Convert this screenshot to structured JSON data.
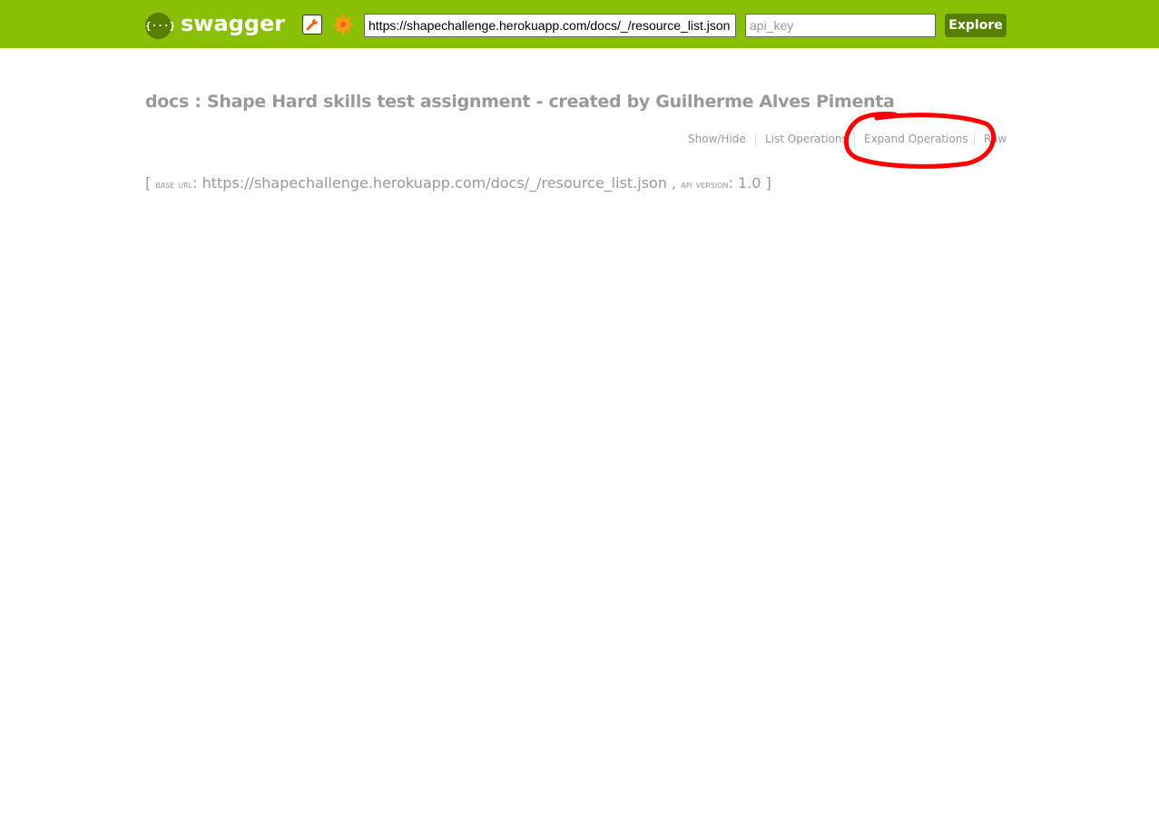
{
  "header": {
    "logo_symbol": "{···}",
    "logo_text": "swagger",
    "url_value": "https://shapechallenge.herokuapp.com/docs/_/resource_list.json",
    "api_key_placeholder": "api_key",
    "explore_label": "Explore",
    "icons": [
      "wrench-icon",
      "gear-icon"
    ],
    "colors": {
      "bar": "#89bf04",
      "button": "#547f00",
      "wrench": "#e8651c",
      "gear": "#f39c12"
    }
  },
  "main": {
    "title": "docs : Shape Hard skills test assignment - created by Guilherme Alves Pimenta",
    "operations": [
      "Show/Hide",
      "List Operations",
      "Expand Operations",
      "Raw"
    ],
    "base_url_label": "base url",
    "base_url_value": "https://shapechallenge.herokuapp.com/docs/_/resource_list.json",
    "api_version_label": "api version",
    "api_version_value": "1.0"
  },
  "annotation": {
    "color": "#ff0000"
  }
}
